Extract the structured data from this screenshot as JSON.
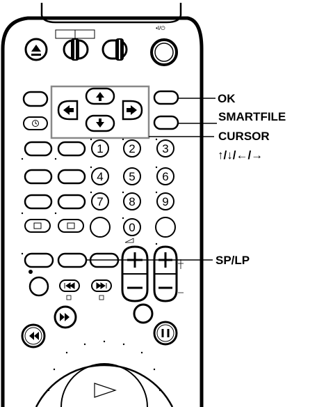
{
  "callouts": {
    "ok": "OK",
    "smartfile": "SMARTFILE",
    "cursor": "CURSOR",
    "cursor_arrows": "↑/↓/←/→",
    "splp": "SP/LP"
  },
  "keypad": [
    "1",
    "2",
    "3",
    "4",
    "5",
    "6",
    "7",
    "8",
    "9",
    "0"
  ],
  "power_label": "•I/⏻",
  "colors": {
    "ink": "#000000",
    "frame": "#888888",
    "paper": "#ffffff"
  }
}
